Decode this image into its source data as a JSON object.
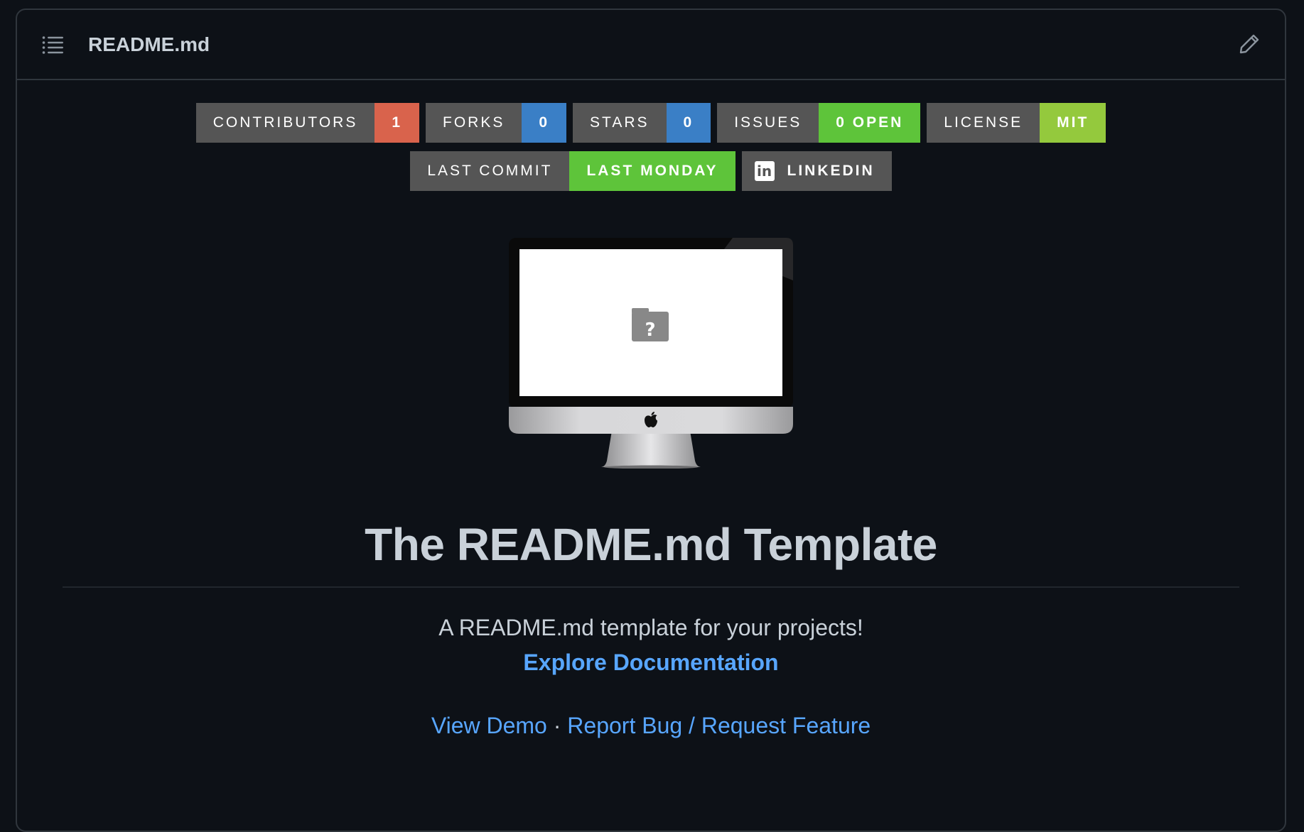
{
  "header": {
    "file_name": "README.md"
  },
  "badges_row1": [
    {
      "label": "CONTRIBUTORS",
      "value": "1",
      "color": "#e05d44"
    },
    {
      "label": "FORKS",
      "value": "0",
      "color": "#007ec6"
    },
    {
      "label": "STARS",
      "value": "0",
      "color": "#007ec6"
    },
    {
      "label": "ISSUES",
      "value": "0 OPEN",
      "color": "#4c1"
    },
    {
      "label": "LICENSE",
      "value": "MIT",
      "color": "#97ca00"
    }
  ],
  "badges_row2": {
    "last_commit": {
      "label": "LAST COMMIT",
      "value": "LAST MONDAY",
      "color": "#4c1"
    },
    "linkedin": {
      "label": "LINKEDIN",
      "icon_text": "in"
    }
  },
  "logo": {
    "icon": "imac-placeholder-icon",
    "placeholder_mark": "?"
  },
  "readme": {
    "title": "The README.md Template",
    "tagline": "A README.md template for your projects!",
    "explore_link": "Explore Documentation",
    "view_demo_link": "View Demo",
    "separator": " · ",
    "report_link": "Report Bug / Request Feature"
  },
  "colors": {
    "background": "#0d1117",
    "border": "#30363d",
    "link": "#58a6ff",
    "badge_label": "#555555"
  }
}
